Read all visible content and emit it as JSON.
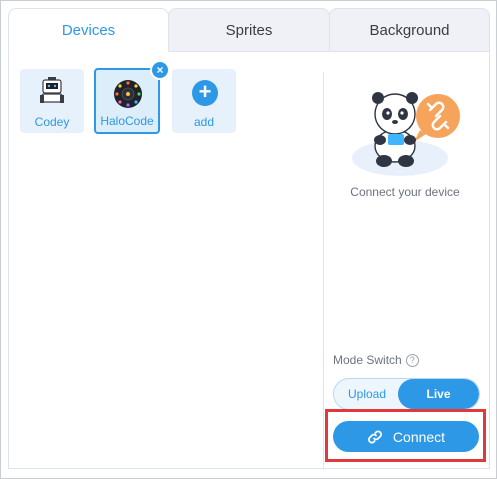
{
  "tabs": [
    {
      "label": "Devices",
      "active": true
    },
    {
      "label": "Sprites",
      "active": false
    },
    {
      "label": "Background",
      "active": false
    }
  ],
  "devices": [
    {
      "label": "Codey",
      "icon": "codey-robot-icon",
      "selected": false
    },
    {
      "label": "HaloCode",
      "icon": "halocode-board-icon",
      "selected": true
    },
    {
      "label": "add",
      "icon": "plus-icon",
      "selected": false
    }
  ],
  "remove_badge": "×",
  "connect_hint": "Connect your device",
  "mode_switch": {
    "title": "Mode Switch",
    "help": "?",
    "options": [
      "Upload",
      "Live"
    ],
    "selected": "Live"
  },
  "connect_button": {
    "label": "Connect",
    "icon": "link-icon"
  },
  "colors": {
    "accent": "#2c98e6",
    "highlight": "#e0393a",
    "tile_bg": "#e6f1fb"
  }
}
